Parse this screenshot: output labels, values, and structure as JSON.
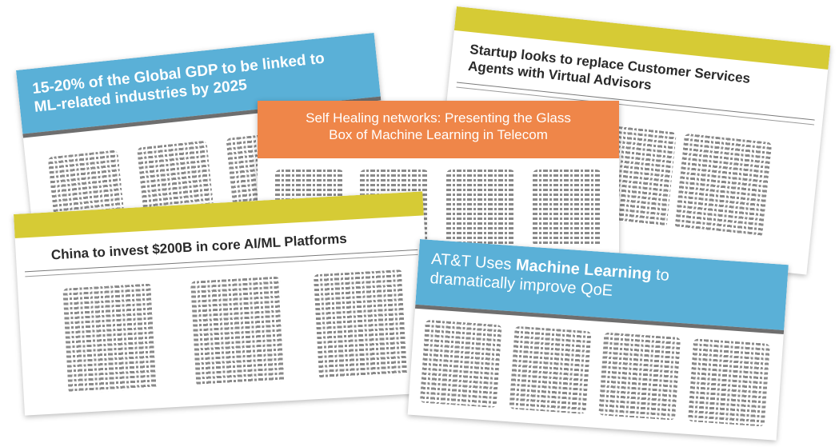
{
  "cards": {
    "gdp": {
      "title_line1": "15-20% of the Global GDP to be linked to",
      "title_line2": "ML-related industries by 2025",
      "color": "#5ab0d7"
    },
    "startup": {
      "title_line1": "Startup looks to replace Customer Services",
      "title_line2": "Agents with Virtual Advisors",
      "color": "#d6cb35"
    },
    "selfheal": {
      "title_line1": "Self Healing networks: Presenting the Glass",
      "title_line2": "Box of Machine Learning in Telecom",
      "color": "#ef8649"
    },
    "china": {
      "title": "China to invest $200B in core AI/ML Platforms",
      "color": "#d6cb35"
    },
    "att": {
      "title_prefix": "AT&T Uses ",
      "title_bold": "Machine Learning",
      "title_suffix": " to",
      "title_line2": "dramatically improve QoE",
      "color": "#5ab0d7"
    }
  }
}
